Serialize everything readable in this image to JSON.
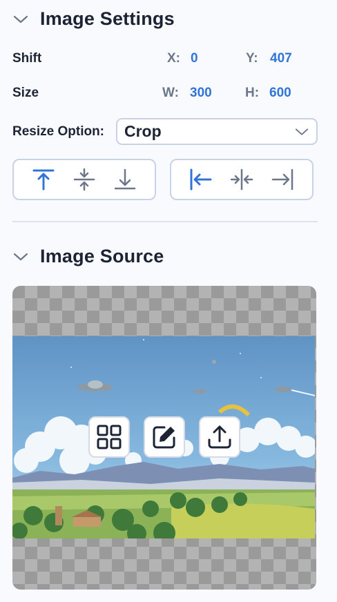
{
  "image_settings": {
    "title": "Image Settings",
    "shift": {
      "label": "Shift",
      "x_key": "X:",
      "x_value": "0",
      "y_key": "Y:",
      "y_value": "407"
    },
    "size": {
      "label": "Size",
      "w_key": "W:",
      "w_value": "300",
      "h_key": "H:",
      "h_value": "600"
    },
    "resize": {
      "label": "Resize Option:",
      "value": "Crop"
    },
    "vertical_align_icons": [
      "align-top-icon",
      "align-middle-icon",
      "align-bottom-icon"
    ],
    "horizontal_align_icons": [
      "align-left-icon",
      "align-center-icon",
      "align-right-icon"
    ]
  },
  "image_source": {
    "title": "Image Source",
    "actions": [
      "grid-icon",
      "edit-icon",
      "upload-icon"
    ]
  },
  "colors": {
    "accent": "#2f74d9",
    "text": "#1c2434",
    "muted": "#6b7789",
    "border": "#c7d2e6"
  }
}
